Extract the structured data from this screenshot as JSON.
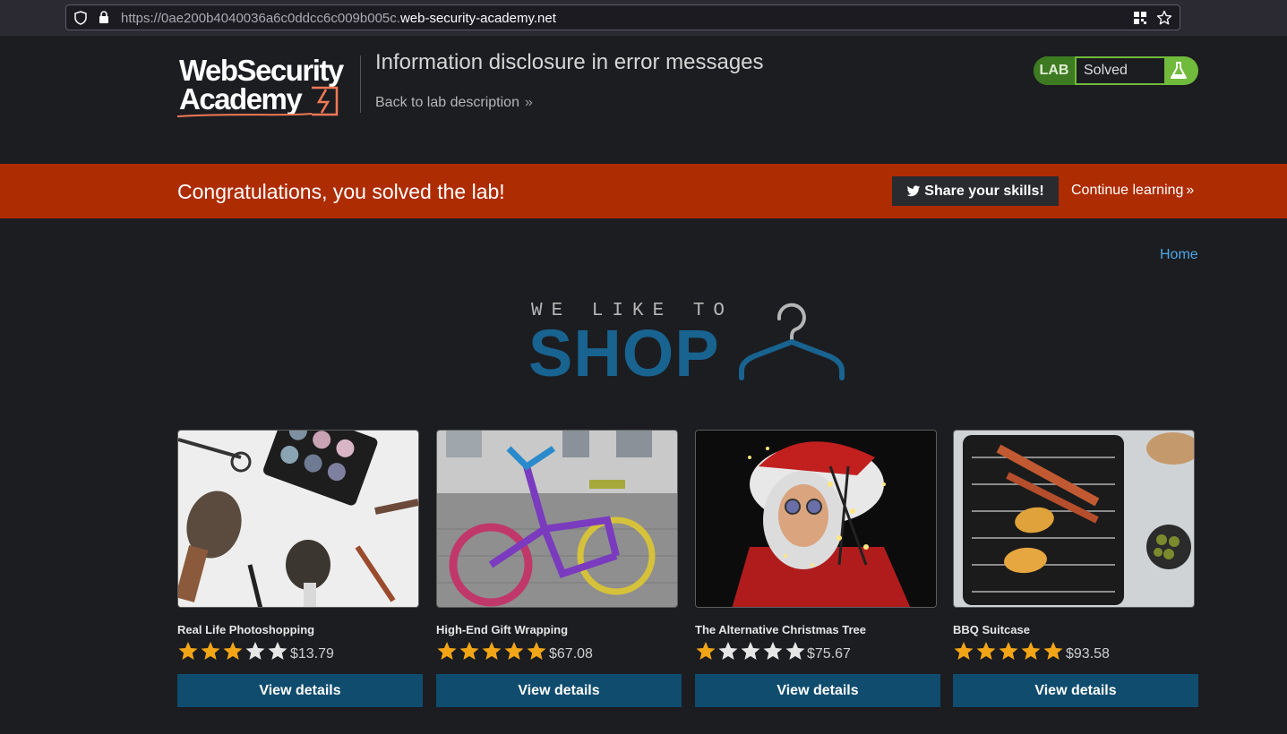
{
  "browser": {
    "url_prefix": "https://0ae200b4040036a6c0ddcc6c009b005c.",
    "url_domain": "web-security-academy.net"
  },
  "header": {
    "logo_line1": "WebSecurity",
    "logo_line2": "Academy",
    "lab_title": "Information disclosure in error messages",
    "back_link": "Back to lab description",
    "lab_badge": "LAB",
    "lab_status": "Solved"
  },
  "banner": {
    "message": "Congratulations, you solved the lab!",
    "share_label": "Share your skills!",
    "continue_label": "Continue learning"
  },
  "nav": {
    "home": "Home"
  },
  "shop_logo": {
    "top": "WE LIKE TO",
    "word": "SHOP"
  },
  "colors": {
    "accent": "#0f4c6e",
    "banner": "#ae2c02",
    "star": "#f2a516",
    "solved": "#70bb3b"
  },
  "products": [
    {
      "name": "Real Life Photoshopping",
      "rating": 3,
      "price": "$13.79",
      "button": "View details",
      "image": "makeup-brushes-photo"
    },
    {
      "name": "High-End Gift Wrapping",
      "rating": 5,
      "price": "$67.08",
      "button": "View details",
      "image": "yarn-wrapped-bicycle-photo"
    },
    {
      "name": "The Alternative Christmas Tree",
      "rating": 1,
      "price": "$75.67",
      "button": "View details",
      "image": "santa-with-lights-photo"
    },
    {
      "name": "BBQ Suitcase",
      "rating": 5,
      "price": "$93.58",
      "button": "View details",
      "image": "bbq-grill-photo"
    }
  ]
}
